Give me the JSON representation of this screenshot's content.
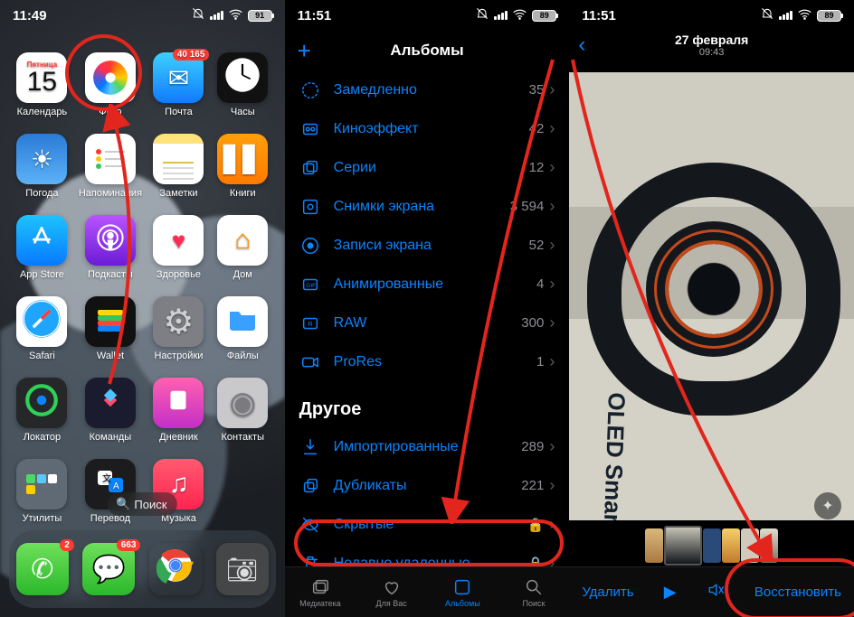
{
  "colors": {
    "accent": "#0a84ff",
    "anno": "#e2261d",
    "badge": "#ff3b30"
  },
  "screen1": {
    "status": {
      "time": "11:49",
      "battery": "91"
    },
    "calendar": {
      "weekday": "Пятница",
      "day": "15"
    },
    "mail_badge": "40 165",
    "apps": [
      {
        "id": "calendar",
        "label": "Календарь"
      },
      {
        "id": "photos",
        "label": "Фото"
      },
      {
        "id": "mail",
        "label": "Почта"
      },
      {
        "id": "clock",
        "label": "Часы"
      },
      {
        "id": "weather",
        "label": "Погода"
      },
      {
        "id": "reminders",
        "label": "Напоминания"
      },
      {
        "id": "notes",
        "label": "Заметки"
      },
      {
        "id": "books",
        "label": "Книги"
      },
      {
        "id": "appstore",
        "label": "App Store"
      },
      {
        "id": "podcasts",
        "label": "Подкасты"
      },
      {
        "id": "health",
        "label": "Здоровье"
      },
      {
        "id": "home",
        "label": "Дом"
      },
      {
        "id": "safari",
        "label": "Safari"
      },
      {
        "id": "wallet",
        "label": "Wallet"
      },
      {
        "id": "settings",
        "label": "Настройки"
      },
      {
        "id": "files",
        "label": "Файлы"
      },
      {
        "id": "findmy",
        "label": "Локатор"
      },
      {
        "id": "shortcuts",
        "label": "Команды"
      },
      {
        "id": "journal",
        "label": "Дневник"
      },
      {
        "id": "contacts",
        "label": "Контакты"
      },
      {
        "id": "utilities",
        "label": "Утилиты"
      },
      {
        "id": "translate",
        "label": "Перевод"
      },
      {
        "id": "music",
        "label": "Музыка"
      }
    ],
    "search": "Поиск",
    "dock": {
      "phone_badge": "2",
      "messages_badge": "663"
    }
  },
  "screen2": {
    "status": {
      "time": "11:51",
      "battery": "89"
    },
    "title": "Альбомы",
    "media_types": [
      {
        "icon": "slowmo",
        "name": "Замедленно",
        "count": "35"
      },
      {
        "icon": "cinematic",
        "name": "Киноэффект",
        "count": "42"
      },
      {
        "icon": "burst",
        "name": "Серии",
        "count": "12"
      },
      {
        "icon": "screenshot",
        "name": "Снимки экрана",
        "count": "3 594"
      },
      {
        "icon": "screenrec",
        "name": "Записи экрана",
        "count": "52"
      },
      {
        "icon": "animated",
        "name": "Анимированные",
        "count": "4"
      },
      {
        "icon": "raw",
        "name": "RAW",
        "count": "300"
      },
      {
        "icon": "prores",
        "name": "ProRes",
        "count": "1"
      }
    ],
    "other_header": "Другое",
    "other": [
      {
        "icon": "import",
        "name": "Импортированные",
        "count": "289"
      },
      {
        "icon": "duplicate",
        "name": "Дубликаты",
        "count": "221"
      },
      {
        "icon": "hidden",
        "name": "Скрытые",
        "locked": true
      },
      {
        "icon": "trash",
        "name": "Недавно удаленные",
        "locked": true
      }
    ],
    "tabs": [
      {
        "id": "library",
        "label": "Медиатека"
      },
      {
        "id": "foryou",
        "label": "Для Вас"
      },
      {
        "id": "albums",
        "label": "Альбомы",
        "active": true
      },
      {
        "id": "search",
        "label": "Поиск"
      }
    ]
  },
  "screen3": {
    "status": {
      "time": "11:51",
      "battery": "89"
    },
    "date": "27 февраля",
    "time": "09:43",
    "photo_label": "OLED Smart Key",
    "actions": {
      "delete": "Удалить",
      "restore": "Восстановить"
    }
  }
}
